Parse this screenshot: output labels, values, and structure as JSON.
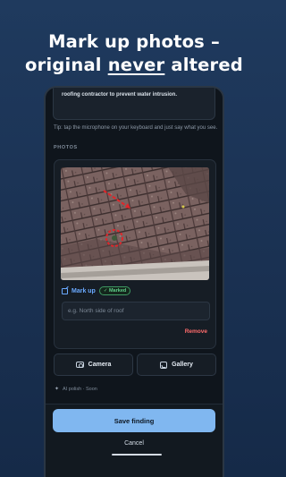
{
  "headline": {
    "line1": "Mark up photos –",
    "line2_a": "original ",
    "line2_u": "never",
    "line2_b": " altered"
  },
  "form": {
    "notes_text": "roofing contractor to prevent water intrusion.",
    "tip": "Tip: tap the microphone on your keyboard and just say what you see.",
    "photos_label": "PHOTOS"
  },
  "photo_card": {
    "markup_label": "Mark up",
    "marked_badge": "✓ Marked",
    "caption_placeholder": "e.g. North side of roof",
    "caption_value": "",
    "remove_label": "Remove"
  },
  "actions": {
    "camera_label": "Camera",
    "gallery_label": "Gallery",
    "ai_polish": "AI polish · Soon"
  },
  "footer": {
    "save_label": "Save finding",
    "cancel_label": "Cancel"
  },
  "colors": {
    "accent": "#80b7f0",
    "link": "#6aa9ff",
    "success": "#5fd08a",
    "danger": "#ff6b6b",
    "markup": "#e0262a"
  }
}
